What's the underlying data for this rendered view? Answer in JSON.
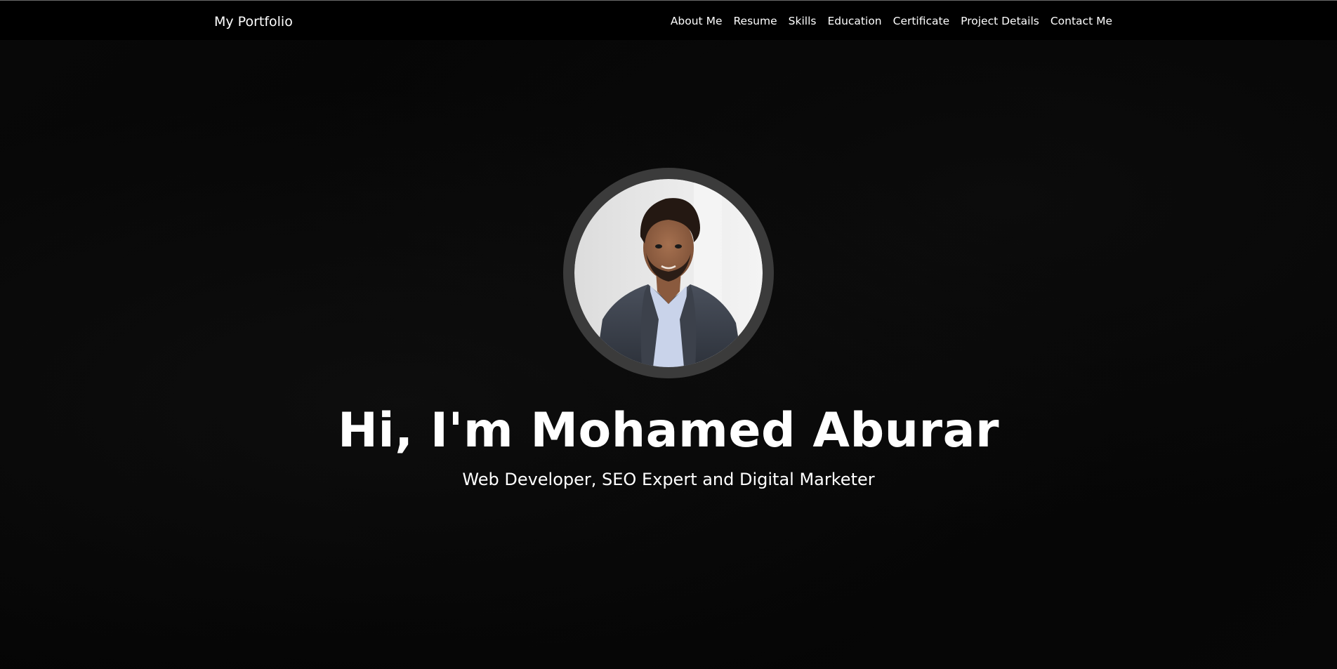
{
  "navbar": {
    "brand": "My Portfolio",
    "links": [
      "About Me",
      "Resume",
      "Skills",
      "Education",
      "Certificate",
      "Project Details",
      "Contact Me"
    ]
  },
  "hero": {
    "headline": "Hi, I'm Mohamed Aburar",
    "subtitle": "Web Developer, SEO Expert and Digital Marketer",
    "avatar_icon": "profile-photo"
  },
  "colors": {
    "background": "#050505",
    "navbar": "#000000",
    "text": "#ffffff",
    "avatar_ring": "#3b3b3b"
  }
}
